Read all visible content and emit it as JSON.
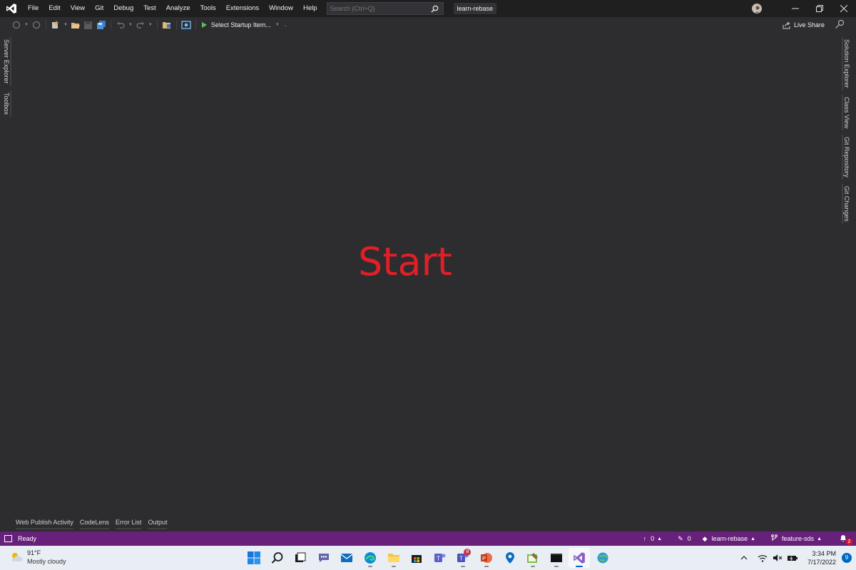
{
  "menu": {
    "items": [
      "File",
      "Edit",
      "View",
      "Git",
      "Debug",
      "Test",
      "Analyze",
      "Tools",
      "Extensions",
      "Window",
      "Help"
    ]
  },
  "search": {
    "placeholder": "Search (Ctrl+Q)"
  },
  "solution_name": "learn-rebase",
  "toolbar": {
    "startup_label": "Select Startup Item...",
    "live_share_label": "Live Share"
  },
  "left_tabs": [
    "Server Explorer",
    "Toolbox"
  ],
  "right_tabs": [
    "Solution Explorer",
    "Class View",
    "Git Repository",
    "Git Changes"
  ],
  "editor": {
    "overlay_text": "Start",
    "overlay_color": "#e21f26"
  },
  "bottom_tabs": [
    "Web Publish Activity",
    "CodeLens",
    "Error List",
    "Output"
  ],
  "status": {
    "ready": "Ready",
    "push_count": "0",
    "pending_changes": "0",
    "repo": "learn-rebase",
    "branch": "feature-sds",
    "notifications": "2",
    "accent": "#68217a"
  },
  "taskbar": {
    "weather_temp": "91°F",
    "weather_desc": "Mostly cloudy",
    "teams_badge": "8",
    "time": "3:34 PM",
    "date": "7/17/2022",
    "notification_count": "9"
  }
}
